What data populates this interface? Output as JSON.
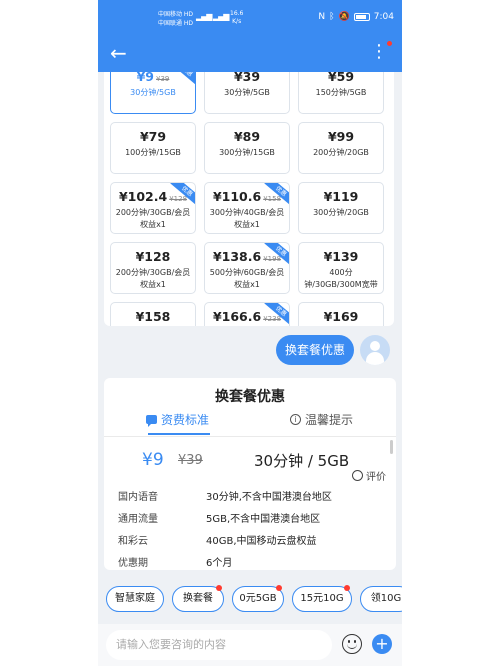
{
  "status_bar": {
    "carrier1": "中国移动 HD",
    "carrier2": "中国联通 HD",
    "speed_value": "16.6",
    "speed_unit": "K/s",
    "time": "7:04"
  },
  "plans": [
    {
      "price": "¥9",
      "old": "¥39",
      "desc": "30分钟/5GB",
      "selected": true,
      "ribbon": true
    },
    {
      "price": "¥39",
      "old": "",
      "desc": "30分钟/5GB",
      "selected": false,
      "ribbon": false
    },
    {
      "price": "¥59",
      "old": "",
      "desc": "150分钟/5GB",
      "selected": false,
      "ribbon": false
    },
    {
      "price": "¥79",
      "old": "",
      "desc": "100分钟/15GB",
      "selected": false,
      "ribbon": false
    },
    {
      "price": "¥89",
      "old": "",
      "desc": "300分钟/15GB",
      "selected": false,
      "ribbon": false
    },
    {
      "price": "¥99",
      "old": "",
      "desc": "200分钟/20GB",
      "selected": false,
      "ribbon": false
    },
    {
      "price": "¥102.4",
      "old": "¥128",
      "desc": "200分钟/30GB/会员权益x1",
      "selected": false,
      "ribbon": true
    },
    {
      "price": "¥110.6",
      "old": "¥158",
      "desc": "300分钟/40GB/会员权益x1",
      "selected": false,
      "ribbon": true
    },
    {
      "price": "¥119",
      "old": "",
      "desc": "300分钟/20GB",
      "selected": false,
      "ribbon": false
    },
    {
      "price": "¥128",
      "old": "",
      "desc": "200分钟/30GB/会员权益x1",
      "selected": false,
      "ribbon": false
    },
    {
      "price": "¥138.6",
      "old": "¥198",
      "desc": "500分钟/60GB/会员权益x1",
      "selected": false,
      "ribbon": true
    },
    {
      "price": "¥139",
      "old": "",
      "desc": "400分钟/30GB/300M宽带",
      "selected": false,
      "ribbon": false
    },
    {
      "price": "¥158",
      "old": "",
      "desc": "",
      "selected": false,
      "ribbon": false
    },
    {
      "price": "¥166.6",
      "old": "¥238",
      "desc": "",
      "selected": false,
      "ribbon": true
    },
    {
      "price": "¥169",
      "old": "",
      "desc": "",
      "selected": false,
      "ribbon": false
    }
  ],
  "ribbon_text": "优惠",
  "chat": {
    "bubble": "换套餐优惠"
  },
  "offer": {
    "title": "换套餐优惠",
    "tab_rate": "资费标准",
    "tab_tips": "温馨提示",
    "price": "¥9",
    "old_price": "¥39",
    "plan": "30分钟 / 5GB",
    "eval": "评价",
    "details": [
      {
        "label": "国内语音",
        "value": "30分钟,不含中国港澳台地区"
      },
      {
        "label": "通用流量",
        "value": "5GB,不含中国港澳台地区"
      },
      {
        "label": "和彩云",
        "value": "40GB,中国移动云盘权益"
      },
      {
        "label": "优惠期",
        "value": "6个月"
      }
    ]
  },
  "chips": [
    "智慧家庭",
    "换套餐",
    "0元5GB",
    "15元10G",
    "领10G"
  ],
  "input": {
    "placeholder": "请输入您要咨询的内容"
  },
  "colors": {
    "accent": "#3a8bf2",
    "badge": "#ff3b30"
  }
}
